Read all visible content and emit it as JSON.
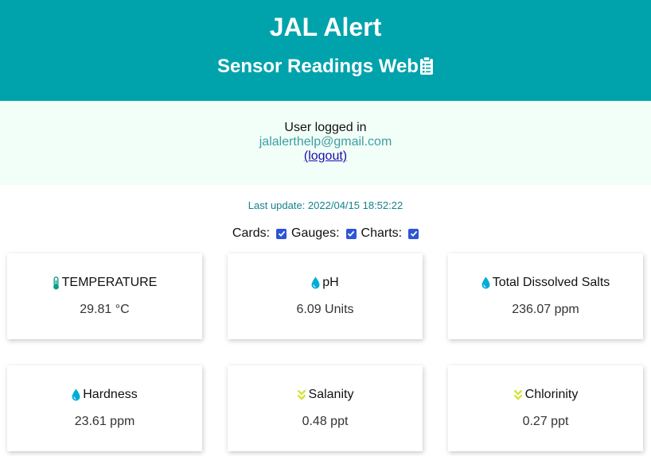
{
  "header": {
    "title": "JAL Alert",
    "subtitle": "Sensor Readings Web",
    "subtitle_icon": "clipboard-list-icon",
    "background_color": "#00a3ac"
  },
  "user": {
    "label": "User logged in",
    "email": "jalalerthelp@gmail.com",
    "logout_label": "(logout)"
  },
  "status": {
    "last_update": "Last update: 2022/04/15 18:52:22"
  },
  "toggles": [
    {
      "label": "Cards:",
      "checked": true
    },
    {
      "label": "Gauges:",
      "checked": true
    },
    {
      "label": "Charts:",
      "checked": true
    }
  ],
  "cards": [
    {
      "title": "TEMPERATURE",
      "value": "29.81 °C",
      "icon": "thermometer-icon",
      "icon_color": "#059e8a"
    },
    {
      "title": "pH",
      "value": "6.09 Units",
      "icon": "droplet-icon",
      "icon_color": "#00add6"
    },
    {
      "title": "Total Dissolved Salts",
      "value": "236.07 ppm",
      "icon": "droplet-icon",
      "icon_color": "#00add6"
    },
    {
      "title": "Hardness",
      "value": "23.61 ppm",
      "icon": "droplet-icon",
      "icon_color": "#00add6"
    },
    {
      "title": "Salanity",
      "value": "0.48 ppt",
      "icon": "chevron-double-down-icon",
      "icon_color": "#d4e33a"
    },
    {
      "title": "Chlorinity",
      "value": "0.27 ppt",
      "icon": "chevron-double-down-icon",
      "icon_color": "#d4e33a"
    }
  ]
}
